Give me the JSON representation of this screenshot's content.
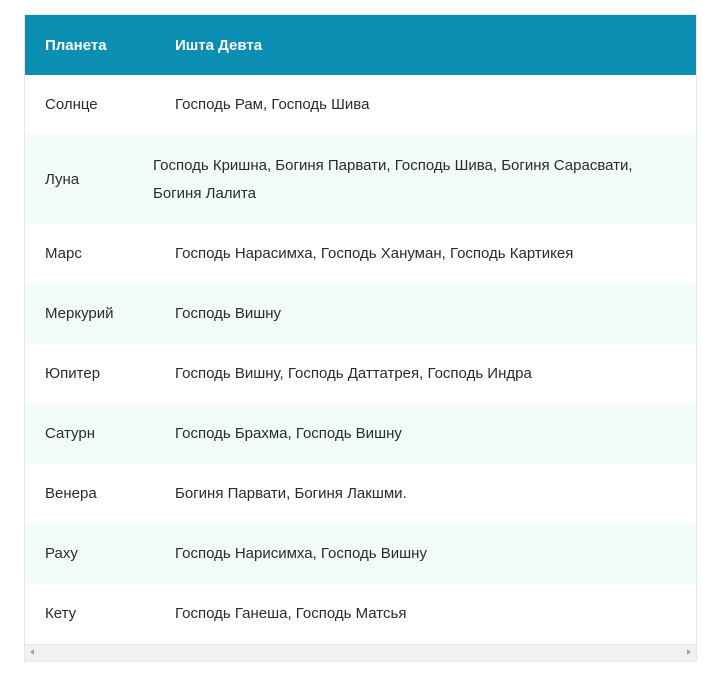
{
  "table": {
    "headers": {
      "planet": "Планета",
      "deity": "Ишта Девта"
    },
    "rows": [
      {
        "planet": "Солнце",
        "deity": "Господь Рам, Господь Шива"
      },
      {
        "planet": "Луна",
        "deity": "Господь Кришна, Богиня Парвати, Господь Шива, Богиня Сарасвати, Богиня Лалита"
      },
      {
        "planet": "Марс",
        "deity": "Господь Нарасимха, Господь Хануман, Господь Картикея"
      },
      {
        "planet": "Меркурий",
        "deity": "Господь Вишну"
      },
      {
        "planet": "Юпитер",
        "deity": "Господь Вишну, Господь Даттатрея, Господь Индра"
      },
      {
        "planet": "Сатурн",
        "deity": "Господь Брахма, Господь Вишну"
      },
      {
        "planet": "Венера",
        "deity": "Богиня Парвати, Богиня Лакшми."
      },
      {
        "planet": "Раху",
        "deity": "Господь Нарисимха, Господь Вишну"
      },
      {
        "planet": "Кету",
        "deity": "Господь Ганеша, Господь Матсья"
      }
    ]
  },
  "colors": {
    "header_bg": "#0a8fb3",
    "row_alt_bg": "#f1fbf8"
  },
  "icons": {
    "scroll_left": "scroll-left-icon",
    "scroll_right": "scroll-right-icon"
  }
}
